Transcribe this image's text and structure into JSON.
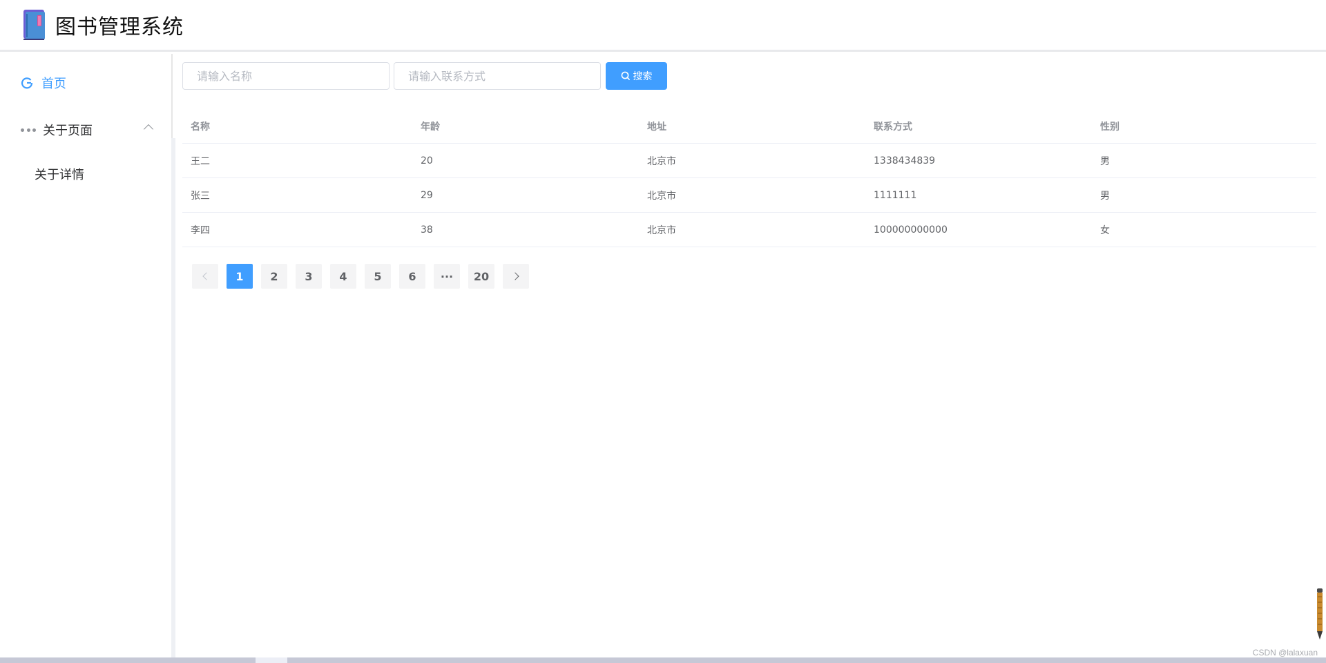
{
  "app": {
    "title": "图书管理系统"
  },
  "sidebar": {
    "items": [
      {
        "label": "首页",
        "icon": "home-icon",
        "active": true
      },
      {
        "label": "关于页面",
        "icon": "dots-icon",
        "expanded": true
      },
      {
        "label": "关于详情",
        "submenu": true
      }
    ]
  },
  "search": {
    "name_placeholder": "请输入名称",
    "contact_placeholder": "请输入联系方式",
    "button_label": "搜索"
  },
  "table": {
    "headers": [
      "名称",
      "年龄",
      "地址",
      "联系方式",
      "性别"
    ],
    "rows": [
      [
        "王二",
        "20",
        "北京市",
        "1338434839",
        "男"
      ],
      [
        "张三",
        "29",
        "北京市",
        "1111111",
        "男"
      ],
      [
        "李四",
        "38",
        "北京市",
        "100000000000",
        "女"
      ]
    ]
  },
  "pagination": {
    "pages": [
      "1",
      "2",
      "3",
      "4",
      "5",
      "6",
      "···",
      "20"
    ],
    "current": "1"
  },
  "watermark": "CSDN @lalaxuan",
  "colors": {
    "primary": "#409eff",
    "text": "#606266",
    "header_text": "#909399"
  }
}
